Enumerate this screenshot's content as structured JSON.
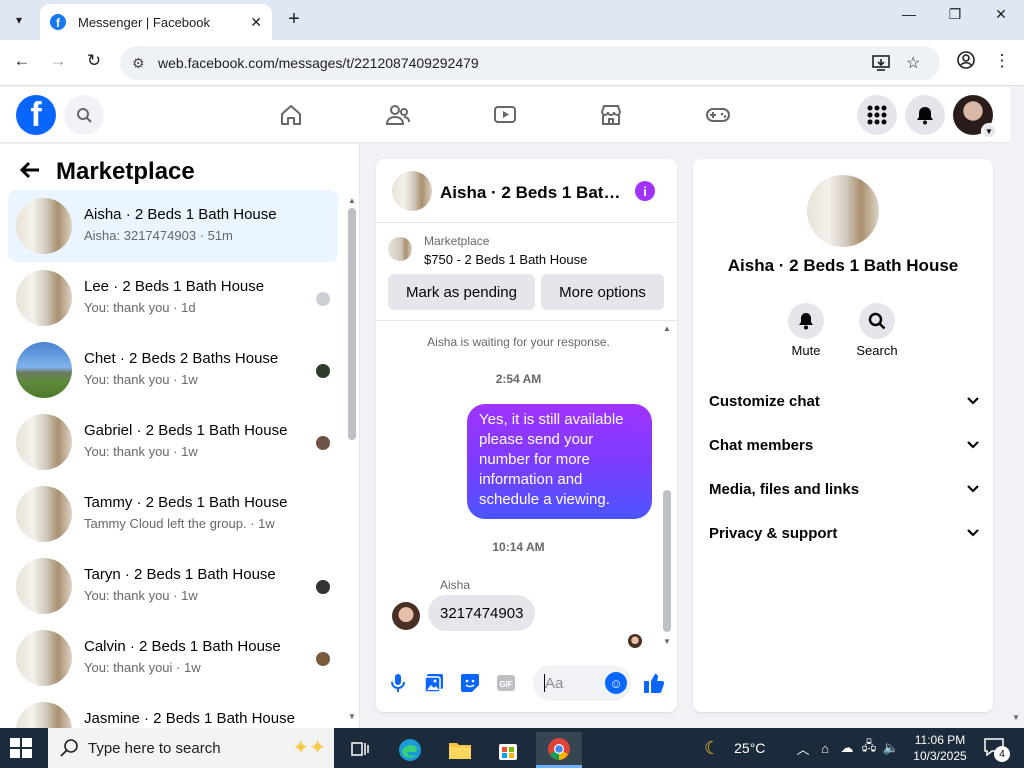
{
  "browser": {
    "tab_title": "Messenger | Facebook",
    "url": "web.facebook.com/messages/t/2212087409292479",
    "favicon_letter": "f"
  },
  "facebook": {
    "logo_letter": "f",
    "brand_color": "#0866ff"
  },
  "left_panel": {
    "title": "Marketplace",
    "conversations": [
      {
        "name": "Aisha · 2 Beds 1 Bath House",
        "preview": "Aisha: 3217474903 · 51m",
        "active": true
      },
      {
        "name": "Lee · 2 Beds 1 Bath House",
        "preview": "You: thank you · 1d"
      },
      {
        "name": "Chet · 2 Beds 2 Baths House",
        "preview": "You: thank you · 1w"
      },
      {
        "name": "Gabriel · 2 Beds 1 Bath House",
        "preview": "You: thank you · 1w"
      },
      {
        "name": "Tammy · 2 Beds 1 Bath House",
        "preview": "Tammy Cloud left the group. · 1w"
      },
      {
        "name": "Taryn · 2 Beds 1 Bath House",
        "preview": "You: thank you · 1w"
      },
      {
        "name": "Calvin · 2 Beds 1 Bath House",
        "preview": "You: thank youi · 1w"
      },
      {
        "name": "Jasmine · 2 Beds 1 Bath House",
        "preview": ""
      }
    ]
  },
  "chat": {
    "title": "Aisha · 2 Beds 1 Bath House",
    "listing_source": "Marketplace",
    "listing_price": "$750 - 2 Beds 1 Bath House",
    "mark_pending_label": "Mark as pending",
    "more_options_label": "More options",
    "waiting_text": "Aisha is waiting for your response.",
    "time1": "2:54 AM",
    "outgoing_message": "Yes, it is still available please send your number for more information and schedule a viewing.",
    "time2": "10:14 AM",
    "sender_name": "Aisha",
    "incoming_message": "3217474903",
    "composer_placeholder": "Aa"
  },
  "right_panel": {
    "name": "Aisha · 2 Beds 1 Bath House",
    "mute_label": "Mute",
    "search_label": "Search",
    "sections": [
      "Customize chat",
      "Chat members",
      "Media, files and links",
      "Privacy & support"
    ]
  },
  "taskbar": {
    "search_placeholder": "Type here to search",
    "temperature": "25°C",
    "time": "11:06 PM",
    "date": "10/3/2025",
    "notification_count": "4"
  }
}
